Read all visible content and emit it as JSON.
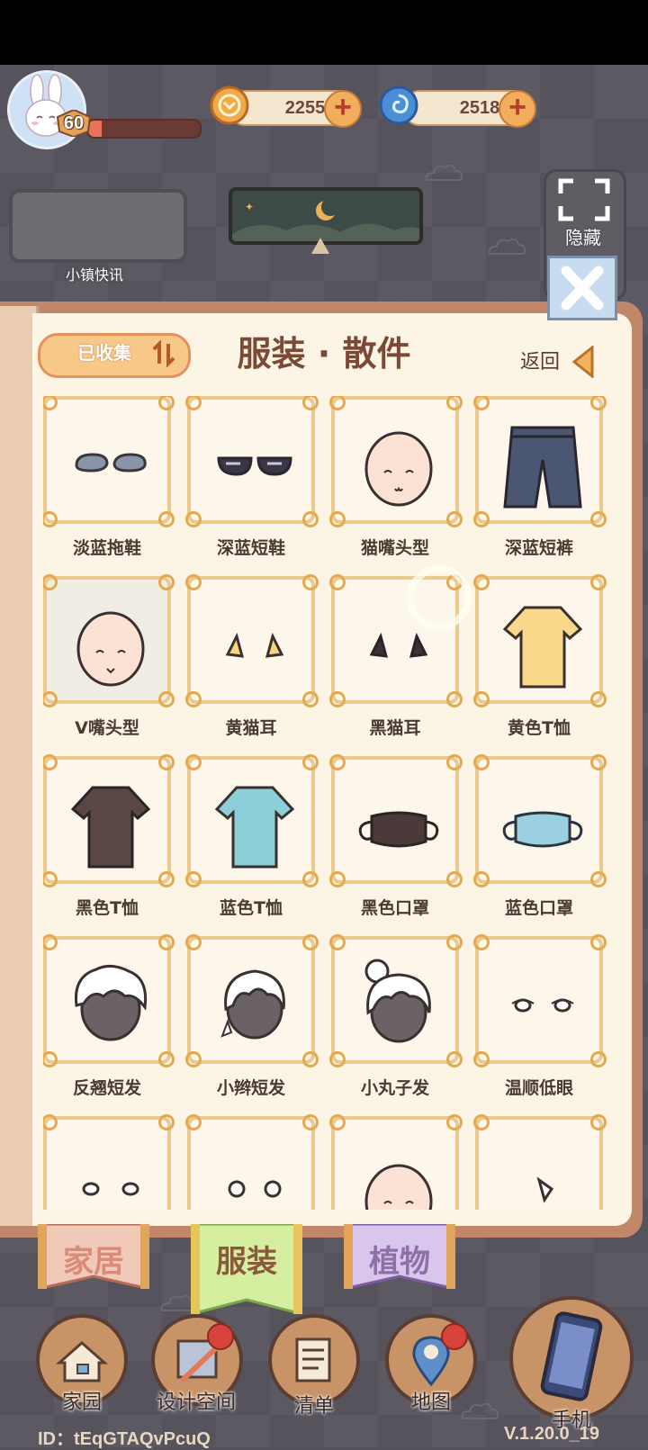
{
  "header": {
    "level": "60",
    "level_progress": 0.12,
    "currency": [
      {
        "icon": "coin-icon",
        "value": "2255"
      },
      {
        "icon": "swirl-gem-icon",
        "value": "2518"
      }
    ],
    "plus_label": "+"
  },
  "news": {
    "label": "小镇快讯"
  },
  "hide": {
    "label": "隐藏"
  },
  "panel": {
    "title": "服装 · 散件",
    "sort_label": "已收集",
    "back_label": "返回"
  },
  "items": [
    {
      "label": "淡蓝拖鞋",
      "icon": "light-blue-slippers-icon"
    },
    {
      "label": "深蓝短鞋",
      "icon": "dark-blue-shoes-icon"
    },
    {
      "label": "猫嘴头型",
      "icon": "cat-mouth-head-icon"
    },
    {
      "label": "深蓝短裤",
      "icon": "dark-blue-shorts-icon"
    },
    {
      "label": "V嘴头型",
      "icon": "v-mouth-head-icon"
    },
    {
      "label": "黄猫耳",
      "icon": "yellow-cat-ears-icon"
    },
    {
      "label": "黑猫耳",
      "icon": "black-cat-ears-icon"
    },
    {
      "label": "黄色T恤",
      "icon": "yellow-tshirt-icon"
    },
    {
      "label": "黑色T恤",
      "icon": "black-tshirt-icon"
    },
    {
      "label": "蓝色T恤",
      "icon": "blue-tshirt-icon"
    },
    {
      "label": "黑色口罩",
      "icon": "black-mask-icon"
    },
    {
      "label": "蓝色口罩",
      "icon": "blue-mask-icon"
    },
    {
      "label": "反翘短发",
      "icon": "flipped-short-hair-icon"
    },
    {
      "label": "小辫短发",
      "icon": "braid-short-hair-icon"
    },
    {
      "label": "小丸子发",
      "icon": "bun-hair-icon"
    },
    {
      "label": "温顺低眼",
      "icon": "gentle-low-eyes-icon"
    },
    {
      "label": "",
      "icon": "eyes-icon"
    },
    {
      "label": "",
      "icon": "round-eyes-icon"
    },
    {
      "label": "",
      "icon": "head-icon"
    },
    {
      "label": "",
      "icon": "nose-icon"
    }
  ],
  "tabs": [
    {
      "label": "家居",
      "color": "#d98a78"
    },
    {
      "label": "服装",
      "color": "#8a5a3c"
    },
    {
      "label": "植物",
      "color": "#8e6fa8"
    }
  ],
  "nav": [
    {
      "label": "家园",
      "icon": "home-icon",
      "badge": false
    },
    {
      "label": "设计空间",
      "icon": "design-space-icon",
      "badge": true
    },
    {
      "label": "清单",
      "icon": "checklist-icon",
      "badge": false
    },
    {
      "label": "地图",
      "icon": "map-pin-icon",
      "badge": true
    },
    {
      "label": "手机",
      "icon": "phone-icon",
      "badge": false
    }
  ],
  "footer": {
    "id": "ID：tEqGTAQvPcuQ",
    "version": "V.1.20.0_19"
  }
}
